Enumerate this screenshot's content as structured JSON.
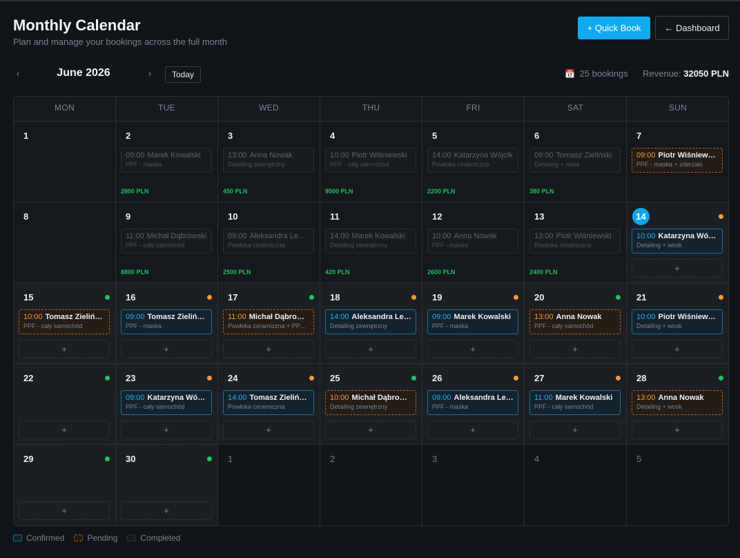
{
  "header": {
    "title": "Monthly Calendar",
    "subtitle": "Plan and manage your bookings across the full month",
    "quick_book_label": "+ Quick Book",
    "dashboard_label": "← Dashboard"
  },
  "nav": {
    "prev": "‹",
    "next": "›",
    "month": "June 2026",
    "today_label": "Today"
  },
  "stats": {
    "calendar_icon": "📅",
    "bookings_text": "25 bookings",
    "revenue_label": "Revenue:",
    "revenue_value": "32050 PLN"
  },
  "weekdays": [
    "MON",
    "TUE",
    "WED",
    "THU",
    "FRI",
    "SAT",
    "SUN"
  ],
  "add_label": "+",
  "today": 14,
  "days": [
    {
      "day": "1",
      "type": "past"
    },
    {
      "day": "2",
      "type": "past",
      "revenue": "2800 PLN",
      "bookings": [
        {
          "time": "09:00",
          "name": "Marek Kowalski",
          "service": "PPF - maska",
          "status": "completed"
        }
      ]
    },
    {
      "day": "3",
      "type": "past",
      "revenue": "450 PLN",
      "bookings": [
        {
          "time": "13:00",
          "name": "Anna Nowak",
          "service": "Detailing zewnętrzny",
          "status": "completed"
        }
      ]
    },
    {
      "day": "4",
      "type": "past",
      "revenue": "9500 PLN",
      "bookings": [
        {
          "time": "10:00",
          "name": "Piotr Wiśniewski",
          "service": "PPF - cały samochód",
          "status": "completed"
        }
      ]
    },
    {
      "day": "5",
      "type": "past",
      "revenue": "2200 PLN",
      "bookings": [
        {
          "time": "14:00",
          "name": "Katarzyna Wójcik",
          "service": "Powłoka ceramiczna",
          "status": "completed"
        }
      ]
    },
    {
      "day": "6",
      "type": "past",
      "revenue": "380 PLN",
      "bookings": [
        {
          "time": "09:00",
          "name": "Tomasz Zieliński",
          "service": "Detailing + wosk",
          "status": "completed"
        }
      ]
    },
    {
      "day": "7",
      "type": "past",
      "bookings": [
        {
          "time": "09:00",
          "name": "Piotr Wiśniewski",
          "service": "PPF - maska + zderzaki",
          "status": "pending"
        }
      ]
    },
    {
      "day": "8",
      "type": "past"
    },
    {
      "day": "9",
      "type": "past",
      "revenue": "8800 PLN",
      "bookings": [
        {
          "time": "11:00",
          "name": "Michał Dąbrowski",
          "service": "PPF - cały samochód",
          "status": "completed"
        }
      ]
    },
    {
      "day": "10",
      "type": "past",
      "revenue": "2500 PLN",
      "bookings": [
        {
          "time": "09:00",
          "name": "Aleksandra Lewak",
          "service": "Powłoka ceramiczna",
          "status": "completed"
        }
      ]
    },
    {
      "day": "11",
      "type": "past",
      "revenue": "420 PLN",
      "bookings": [
        {
          "time": "14:00",
          "name": "Marek Kowalski",
          "service": "Detailing zewnętrzny",
          "status": "completed"
        }
      ]
    },
    {
      "day": "12",
      "type": "past",
      "revenue": "2600 PLN",
      "bookings": [
        {
          "time": "10:00",
          "name": "Anna Nowak",
          "service": "PPF - maska",
          "status": "completed"
        }
      ]
    },
    {
      "day": "13",
      "type": "past",
      "revenue": "2400 PLN",
      "bookings": [
        {
          "time": "13:00",
          "name": "Piotr Wiśniewski",
          "service": "Powłoka ceramiczna",
          "status": "completed"
        }
      ]
    },
    {
      "day": "14",
      "type": "cur",
      "dot": "orange",
      "add": true,
      "bookings": [
        {
          "time": "10:00",
          "name": "Katarzyna Wójcik",
          "service": "Detailing + wosk",
          "status": "confirmed"
        }
      ]
    },
    {
      "day": "15",
      "type": "cur",
      "dot": "green",
      "add": true,
      "bookings": [
        {
          "time": "10:00",
          "name": "Tomasz Zieliński",
          "service": "PPF - cały samochód",
          "status": "pending"
        }
      ]
    },
    {
      "day": "16",
      "type": "cur",
      "dot": "orange",
      "add": true,
      "bookings": [
        {
          "time": "09:00",
          "name": "Tomasz Zieliński",
          "service": "PPF - maska",
          "status": "confirmed"
        }
      ]
    },
    {
      "day": "17",
      "type": "cur",
      "dot": "green",
      "add": true,
      "bookings": [
        {
          "time": "11:00",
          "name": "Michał Dąbrowski",
          "service": "Powłoka ceramiczna + PPF maska",
          "status": "pending"
        }
      ]
    },
    {
      "day": "18",
      "type": "cur",
      "dot": "orange",
      "add": true,
      "bookings": [
        {
          "time": "14:00",
          "name": "Aleksandra Lewak",
          "service": "Detailing zewnętrzny",
          "status": "confirmed"
        }
      ]
    },
    {
      "day": "19",
      "type": "cur",
      "dot": "orange",
      "add": true,
      "bookings": [
        {
          "time": "09:00",
          "name": "Marek Kowalski",
          "service": "PPF - maska",
          "status": "confirmed"
        }
      ]
    },
    {
      "day": "20",
      "type": "cur",
      "dot": "green",
      "add": true,
      "bookings": [
        {
          "time": "13:00",
          "name": "Anna Nowak",
          "service": "PPF - cały samochód",
          "status": "pending"
        }
      ]
    },
    {
      "day": "21",
      "type": "cur",
      "dot": "orange",
      "add": true,
      "bookings": [
        {
          "time": "10:00",
          "name": "Piotr Wiśniewski",
          "service": "Detailing + wosk",
          "status": "confirmed"
        }
      ]
    },
    {
      "day": "22",
      "type": "cur",
      "dot": "green",
      "add": true
    },
    {
      "day": "23",
      "type": "cur",
      "dot": "orange",
      "add": true,
      "bookings": [
        {
          "time": "09:00",
          "name": "Katarzyna Wójcik",
          "service": "PPF - cały samochód",
          "status": "confirmed"
        }
      ]
    },
    {
      "day": "24",
      "type": "cur",
      "dot": "orange",
      "add": true,
      "bookings": [
        {
          "time": "14:00",
          "name": "Tomasz Zieliński",
          "service": "Powłoka ceramiczna",
          "status": "confirmed"
        }
      ]
    },
    {
      "day": "25",
      "type": "cur",
      "dot": "green",
      "add": true,
      "bookings": [
        {
          "time": "10:00",
          "name": "Michał Dąbrowski",
          "service": "Detailing zewnętrzny",
          "status": "pending"
        }
      ]
    },
    {
      "day": "26",
      "type": "cur",
      "dot": "orange",
      "add": true,
      "bookings": [
        {
          "time": "09:00",
          "name": "Aleksandra Lewak",
          "service": "PPF - maska",
          "status": "confirmed"
        }
      ]
    },
    {
      "day": "27",
      "type": "cur",
      "dot": "orange",
      "add": true,
      "bookings": [
        {
          "time": "11:00",
          "name": "Marek Kowalski",
          "service": "PPF - cały samochód",
          "status": "confirmed"
        }
      ]
    },
    {
      "day": "28",
      "type": "cur",
      "dot": "green",
      "add": true,
      "bookings": [
        {
          "time": "13:00",
          "name": "Anna Nowak",
          "service": "Detailing + wosk",
          "status": "pending"
        }
      ]
    },
    {
      "day": "29",
      "type": "cur",
      "dot": "green",
      "add": true
    },
    {
      "day": "30",
      "type": "cur",
      "dot": "green",
      "add": true
    },
    {
      "day": "1",
      "type": "other"
    },
    {
      "day": "2",
      "type": "other"
    },
    {
      "day": "3",
      "type": "other"
    },
    {
      "day": "4",
      "type": "other"
    },
    {
      "day": "5",
      "type": "other"
    }
  ],
  "legend": [
    {
      "label": "Confirmed",
      "status": "confirmed"
    },
    {
      "label": "Pending",
      "status": "pending"
    },
    {
      "label": "Completed",
      "status": "completed"
    }
  ],
  "colors": {
    "accent": "#10aaf0",
    "confirmed": "#29aef0",
    "pending": "#f19a45",
    "revenue": "#1fbf5b",
    "dot_green": "#22c55e",
    "dot_orange": "#f59a3b"
  }
}
